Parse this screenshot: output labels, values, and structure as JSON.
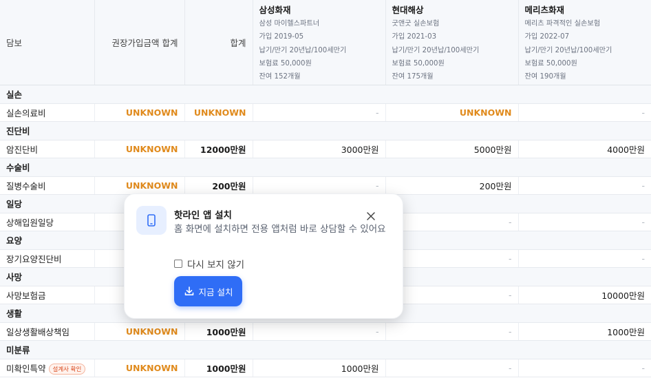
{
  "header": {
    "coverage": "담보",
    "recommended_total": "권장가입금액 합계",
    "total": "합계",
    "insurers": [
      {
        "name": "삼성화재",
        "product": "삼성 마이헬스파트너",
        "joined": "가입 2019-05",
        "terms": "납기/만기 20년납/100세만기",
        "premium": "보험료 50,000원",
        "remaining": "잔여 152개월"
      },
      {
        "name": "현대해상",
        "product": "굿앤굿 실손보험",
        "joined": "가입 2021-03",
        "terms": "납기/만기 20년납/100세만기",
        "premium": "보험료 50,000원",
        "remaining": "잔여 175개월"
      },
      {
        "name": "메리츠화재",
        "product": "메리츠 파격적인 실손보험",
        "joined": "가입 2022-07",
        "terms": "납기/만기 20년납/100세만기",
        "premium": "보험료 50,000원",
        "remaining": "잔여 190개월"
      }
    ]
  },
  "rows": [
    {
      "category": "실손",
      "item": "실손의료비",
      "recommended": "UNKNOWN",
      "total": "UNKNOWN",
      "c1": "-",
      "c2": "UNKNOWN",
      "c3": "-"
    },
    {
      "category": "진단비",
      "item": "암진단비",
      "recommended": "UNKNOWN",
      "total": "12000만원",
      "c1": "3000만원",
      "c2": "5000만원",
      "c3": "4000만원"
    },
    {
      "category": "수술비",
      "item": "질병수술비",
      "recommended": "UNKNOWN",
      "total": "200만원",
      "c1": "-",
      "c2": "200만원",
      "c3": "-"
    },
    {
      "category": "일당",
      "item": "상해입원일당",
      "recommended": "",
      "total": "",
      "c1": "",
      "c2": "-",
      "c3": "-"
    },
    {
      "category": "요양",
      "item": "장기요양진단비",
      "recommended": "",
      "total": "",
      "c1": "",
      "c2": "-",
      "c3": "-"
    },
    {
      "category": "사망",
      "item": "사망보험금",
      "recommended": "",
      "total": "",
      "c1": "",
      "c2": "-",
      "c3": "10000만원"
    },
    {
      "category": "생활",
      "item": "일상생활배상책임",
      "recommended": "UNKNOWN",
      "total": "1000만원",
      "c1": "-",
      "c2": "-",
      "c3": "1000만원"
    },
    {
      "category": "미분류",
      "item": "미확인특약",
      "badge": "설계사 확인",
      "recommended": "UNKNOWN",
      "total": "1000만원",
      "c1": "1000만원",
      "c2": "-",
      "c3": "-"
    }
  ],
  "popup": {
    "title": "핫라인 앱 설치",
    "description": "홈 화면에 설치하면 전용 앱처럼 바로 상담할 수 있어요",
    "checkbox_label": "다시 보지 않기",
    "install_label": "지금 설치"
  },
  "colors": {
    "unknown": "#e08a1c",
    "accent": "#2f6df6",
    "badge": "#d9481c"
  },
  "icons": {
    "close": "close-icon",
    "phone": "phone-icon",
    "download": "download-icon"
  }
}
